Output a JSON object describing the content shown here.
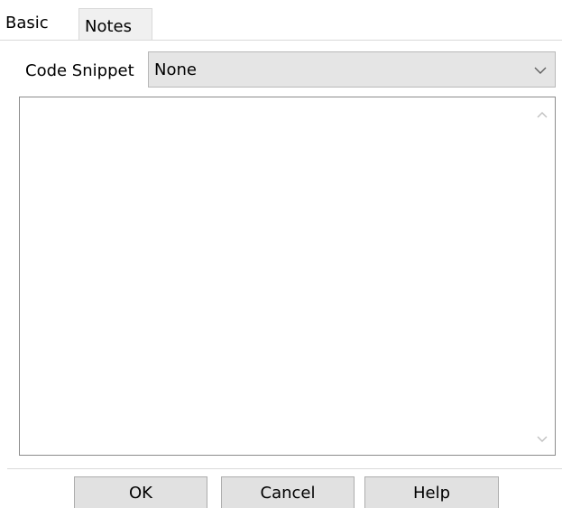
{
  "tabs": [
    {
      "label": "Basic",
      "active": true
    },
    {
      "label": "Notes",
      "active": false
    }
  ],
  "code_snippet": {
    "label": "Code Snippet",
    "value": "None",
    "dropdown_icon": "chevron-down-icon"
  },
  "notes_area": {
    "value": "",
    "scroll_up_icon": "chevron-up-icon",
    "scroll_down_icon": "chevron-down-icon"
  },
  "buttons": {
    "ok": "OK",
    "cancel": "Cancel",
    "help": "Help"
  },
  "colors": {
    "background": "#ffffff",
    "tab_inactive": "#f0f0f0",
    "select_background": "#e5e5e5",
    "button_background": "#e1e1e1",
    "border": "#adadad"
  }
}
